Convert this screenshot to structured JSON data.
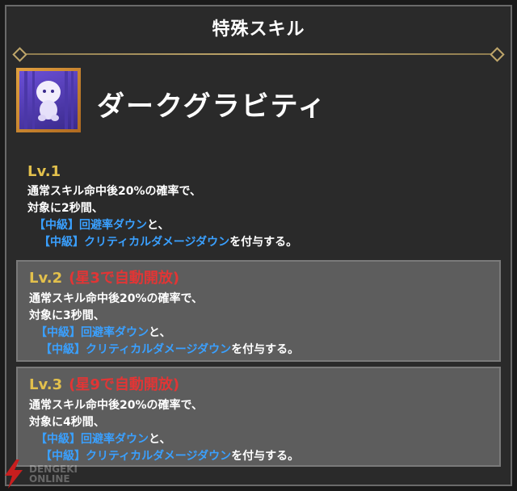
{
  "header": {
    "title": "特殊スキル"
  },
  "skill": {
    "name": "ダークグラビティ",
    "icon": "ghost-skill-icon"
  },
  "levels": [
    {
      "label": "Lv.1",
      "unlock": "",
      "line1": "通常スキル命中後20%の確率で、",
      "line2": "対象に2秒間、",
      "line3_blue": "【中級】回避率ダウン",
      "line3_tail": "と、",
      "line4_blue": "【中級】クリティカルダメージダウン",
      "line4_tail": "を付与する。"
    },
    {
      "label": "Lv.2",
      "unlock": "(星3で自動開放)",
      "line1": "通常スキル命中後20%の確率で、",
      "line2": "対象に3秒間、",
      "line3_blue": "【中級】回避率ダウン",
      "line3_tail": "と、",
      "line4_blue": "【中級】クリティカルダメージダウン",
      "line4_tail": "を付与する。"
    },
    {
      "label": "Lv.3",
      "unlock": "(星9で自動開放)",
      "line1": "通常スキル命中後20%の確率で、",
      "line2": "対象に4秒間、",
      "line3_blue": "【中級】回避率ダウン",
      "line3_tail": "と、",
      "line4_blue": "【中級】クリティカルダメージダウン",
      "line4_tail": "を付与する。"
    }
  ],
  "colors": {
    "level_label": "#e2c04c",
    "unlock": "#e23535",
    "effect_blue": "#3aa0ff",
    "frame_gold": "#bfa66a"
  },
  "watermark": {
    "line1": "DENGEKI",
    "line2": "ONLINE"
  }
}
